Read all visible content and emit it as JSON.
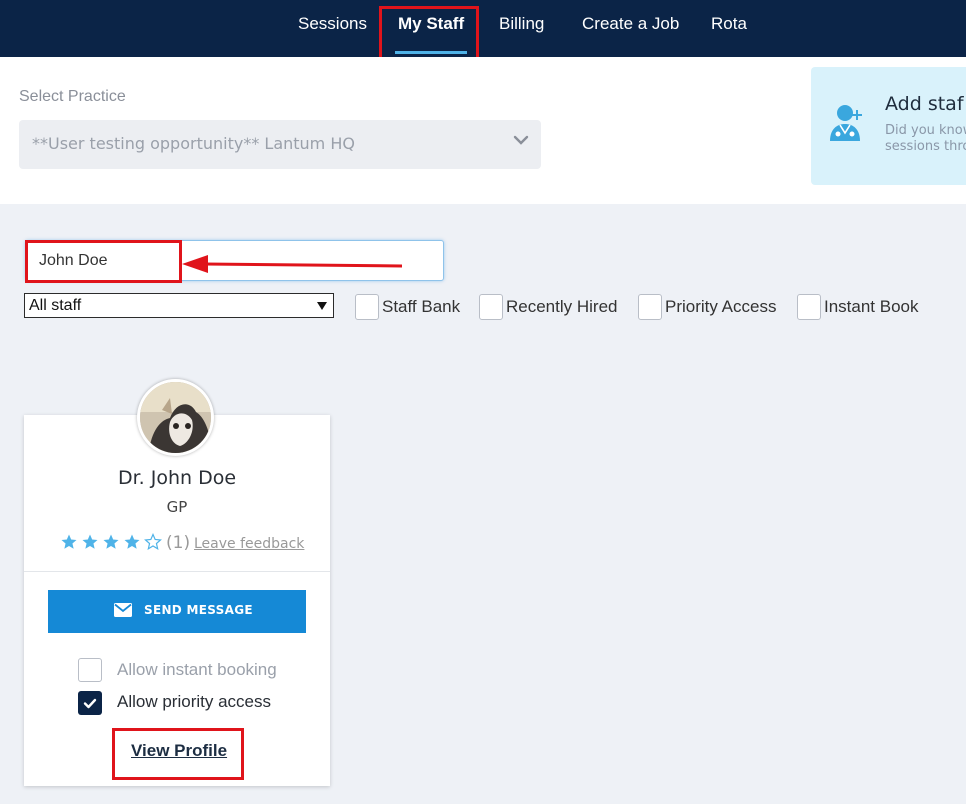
{
  "nav": {
    "items": [
      "Sessions",
      "My Staff",
      "Billing",
      "Create a Job",
      "Rota"
    ],
    "active": "My Staff"
  },
  "practice": {
    "label": "Select Practice",
    "selected": "**User testing opportunity** Lantum HQ"
  },
  "promo": {
    "title": "Add staf",
    "desc_line1": "Did you know",
    "desc_line2": "sessions thro"
  },
  "search": {
    "value": "John Doe"
  },
  "filters": {
    "staff_select": "All staff",
    "options": [
      "Staff Bank",
      "Recently Hired",
      "Priority Access",
      "Instant Book"
    ]
  },
  "card": {
    "name": "Dr. John Doe",
    "role": "GP",
    "rating_stars": 4,
    "rating_max": 5,
    "rating_count": "(1)",
    "leave_feedback": "Leave feedback",
    "send_message": "SEND MESSAGE",
    "allow_instant_booking": "Allow instant booking",
    "allow_priority_access": "Allow priority access",
    "instant_booking_checked": false,
    "priority_access_checked": true,
    "view_profile": "View Profile"
  },
  "colors": {
    "nav_bg": "#0b2447",
    "accent": "#1589d6",
    "star": "#4fb3e8",
    "annotation": "#e0141b"
  }
}
